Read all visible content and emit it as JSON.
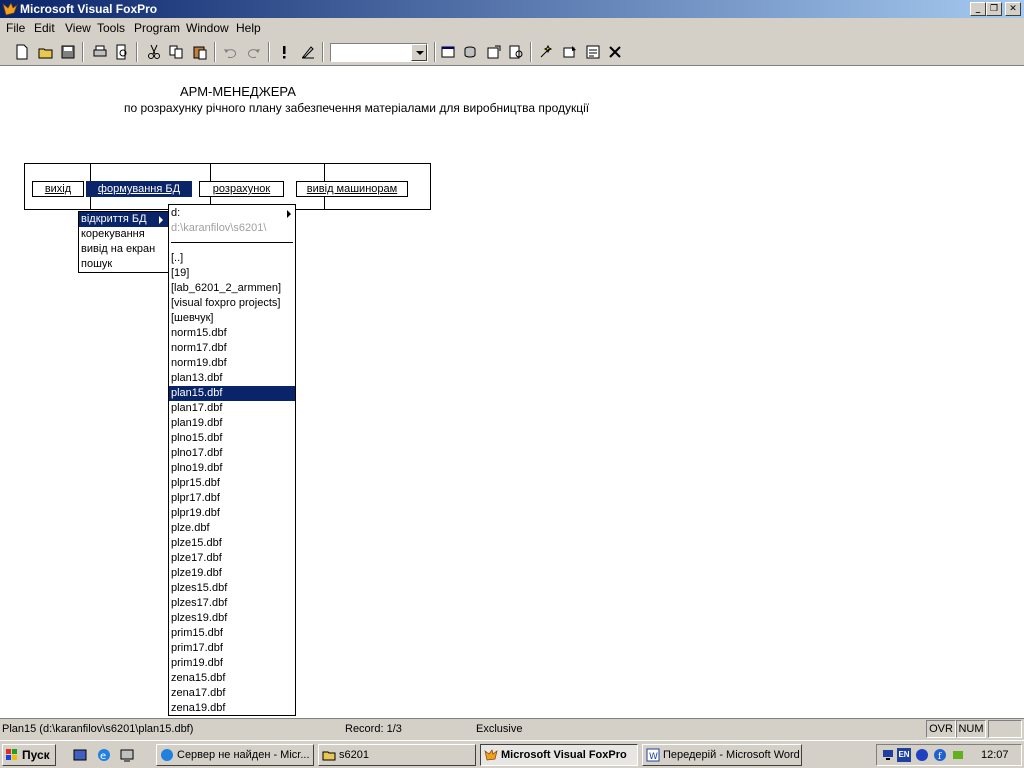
{
  "window": {
    "title": "Microsoft Visual FoxPro",
    "minimize_glyph": "_",
    "maximize_glyph": "❐",
    "close_glyph": "✕"
  },
  "menubar": {
    "items": [
      {
        "label": "File"
      },
      {
        "label": "Edit"
      },
      {
        "label": "View"
      },
      {
        "label": "Tools"
      },
      {
        "label": "Program"
      },
      {
        "label": "Window"
      },
      {
        "label": "Help"
      }
    ]
  },
  "toolbar": {
    "combo_value": ""
  },
  "main": {
    "heading1": "АРМ-МЕНЕДЖЕРА",
    "heading2": "по розрахунку річного  плану забезпечення матеріалами для виробництва продукції",
    "buttons": [
      {
        "label": "вихід"
      },
      {
        "label": "формування БД"
      },
      {
        "label": "розрахунок"
      },
      {
        "label": "вивід машинорам"
      }
    ]
  },
  "submenu": {
    "items": [
      {
        "label": "відкриття БД"
      },
      {
        "label": "корекування"
      },
      {
        "label": "вивід на екран"
      },
      {
        "label": "пошук"
      }
    ]
  },
  "filelist": {
    "drive": "d:",
    "path": "d:\\karanfilov\\s6201\\",
    "selected": "plan15.dbf",
    "items": [
      "[..]",
      "[19]",
      "[lab_6201_2_armmen]",
      "[visual foxpro projects]",
      "[шевчук]",
      "norm15.dbf",
      "norm17.dbf",
      "norm19.dbf",
      "plan13.dbf",
      "plan15.dbf",
      "plan17.dbf",
      "plan19.dbf",
      "plno15.dbf",
      "plno17.dbf",
      "plno19.dbf",
      "plpr15.dbf",
      "plpr17.dbf",
      "plpr19.dbf",
      "plze.dbf",
      "plze15.dbf",
      "plze17.dbf",
      "plze19.dbf",
      "plzes15.dbf",
      "plzes17.dbf",
      "plzes19.dbf",
      "prim15.dbf",
      "prim17.dbf",
      "prim19.dbf",
      "zena15.dbf",
      "zena17.dbf",
      "zena19.dbf"
    ]
  },
  "statusbar": {
    "file": "Plan15 (d:\\karanfilov\\s6201\\plan15.dbf)",
    "record": "Record: 1/3",
    "mode": "Exclusive",
    "ovr": "OVR",
    "num": "NUM"
  },
  "taskbar": {
    "start_label": "Пуск",
    "tasks": [
      {
        "label": "Сервер не найден - Micr..."
      },
      {
        "label": "s6201"
      },
      {
        "label": "Microsoft Visual FoxPro"
      },
      {
        "label": "Передерій - Microsoft Word"
      }
    ],
    "lang": "EN",
    "clock": "12:07"
  },
  "colors": {
    "selection": "#0a246a",
    "chrome": "#d4d0c8"
  }
}
